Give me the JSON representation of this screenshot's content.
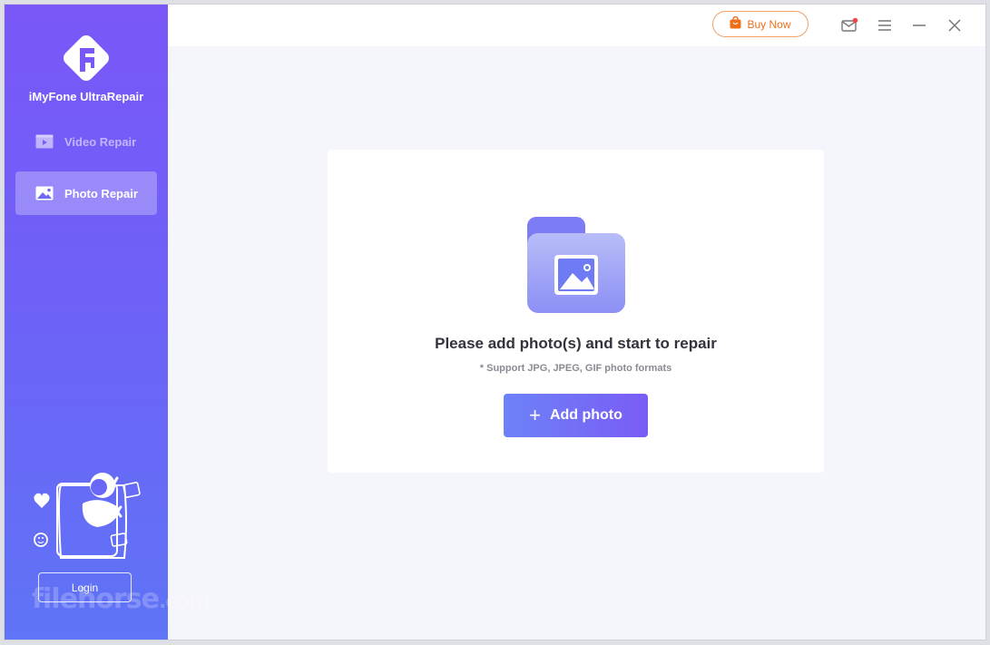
{
  "app": {
    "name": "iMyFone UltraRepair"
  },
  "sidebar": {
    "items": [
      {
        "label": "Video Repair",
        "icon": "video-icon",
        "active": false
      },
      {
        "label": "Photo Repair",
        "icon": "photo-icon",
        "active": true
      }
    ],
    "login_label": "Login"
  },
  "titlebar": {
    "buy_label": "Buy Now",
    "notification_dot": true
  },
  "main": {
    "prompt": "Please add photo(s) and start to repair",
    "formats": "* Support JPG, JPEG, GIF photo formats",
    "add_button_label": "Add photo"
  },
  "watermark": {
    "text": "filehorse",
    "suffix": ".com"
  },
  "colors": {
    "sidebar_top": "#7a57f8",
    "sidebar_bottom": "#5f74f6",
    "accent": "#7367f6",
    "buy_orange": "#f06d1a"
  }
}
